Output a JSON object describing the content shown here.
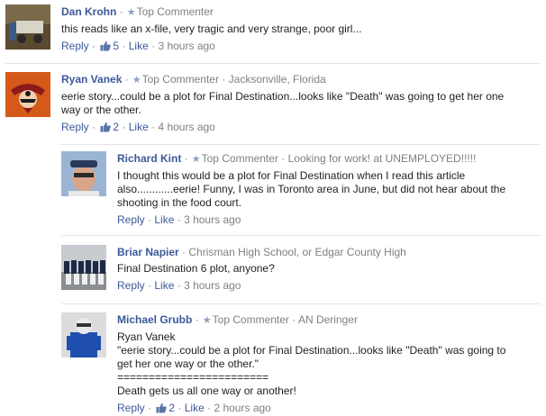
{
  "comments": [
    {
      "author": "Dan Krohn",
      "badge": "Top Commenter",
      "extra": "",
      "text_lines": [
        "this reads like an x-file, very tragic and very strange, poor girl..."
      ],
      "reply": "Reply",
      "likes": "5",
      "like": "Like",
      "time": "3 hours ago"
    },
    {
      "author": "Ryan Vanek",
      "badge": "Top Commenter",
      "extra": "Jacksonville, Florida",
      "text_lines": [
        "eerie story...could be a plot for Final Destination...looks like \"Death\" was going to get her one",
        "way or the other."
      ],
      "reply": "Reply",
      "likes": "2",
      "like": "Like",
      "time": "4 hours ago"
    },
    {
      "author": "Richard Kint",
      "badge": "Top Commenter",
      "extra": "Looking for work! at UNEMPLOYED!!!!!",
      "text_lines": [
        "I thought this would be a plot for Final Destination when I read this article",
        "also............eerie! Funny, I was in Toronto area in June, but did not hear about the",
        "shooting in the food court."
      ],
      "reply": "Reply",
      "likes": "",
      "like": "Like",
      "time": "3 hours ago"
    },
    {
      "author": "Briar Napier",
      "badge": "",
      "extra": "Chrisman High School, or Edgar County High",
      "text_lines": [
        "Final Destination 6 plot, anyone?"
      ],
      "reply": "Reply",
      "likes": "",
      "like": "Like",
      "time": "3 hours ago"
    },
    {
      "author": "Michael Grubb",
      "badge": "Top Commenter",
      "extra": "AN Deringer",
      "text_lines": [
        "Ryan Vanek",
        "\"eerie story...could be a plot for Final Destination...looks like \"Death\" was going to",
        "get her one way or the other.\"",
        "========================",
        "Death gets us all one way or another!"
      ],
      "reply": "Reply",
      "likes": "2",
      "like": "Like",
      "time": "2 hours ago"
    }
  ],
  "separator": "·",
  "colors": {
    "author_link": "#3b5998",
    "meta_gray": "#808080",
    "divider": "#e5e5e5"
  },
  "icons": {
    "badge": "star-icon",
    "like": "thumbs-up-icon"
  }
}
